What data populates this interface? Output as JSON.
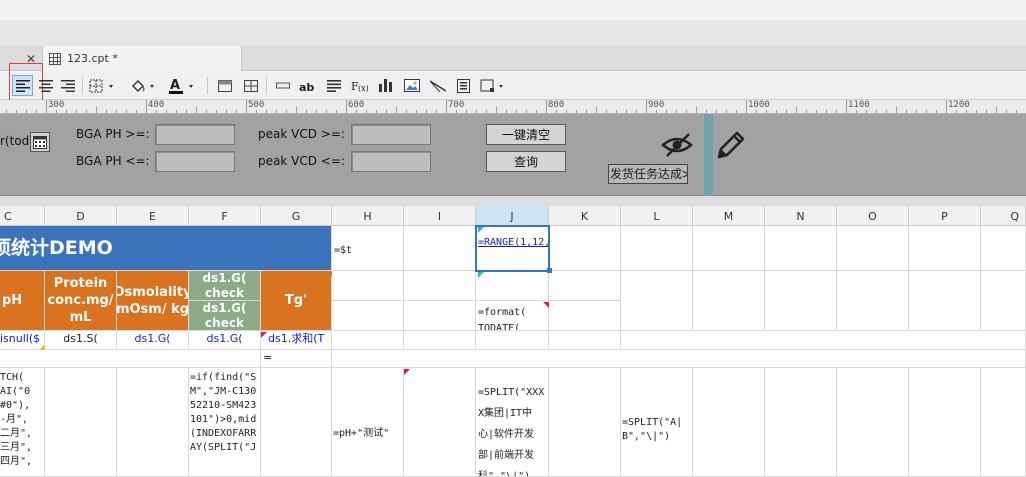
{
  "tabs": {
    "active_label": "123.cpt *"
  },
  "ruler": {
    "labels": [
      "300",
      "400",
      "500",
      "600",
      "700",
      "800",
      "900",
      "1000",
      "1100",
      "1200"
    ]
  },
  "params": {
    "left_label": "r(tod",
    "bga_ph_ge": "BGA PH >=:",
    "bga_ph_le": "BGA PH <=:",
    "peak_vcd_ge": "peak VCD >=:",
    "peak_vcd_le": "peak VCD <=:",
    "clear_btn": "一键清空",
    "query_btn": "查询",
    "shipping_label": "发货任务达成≫"
  },
  "columns": [
    "C",
    "D",
    "E",
    "F",
    "G",
    "H",
    "I",
    "J",
    "K",
    "L",
    "M",
    "N",
    "O",
    "P",
    "Q"
  ],
  "cells": {
    "title": "项统计DEMO",
    "h_formula": "=$t",
    "j_range": "=RANGE(1,12,1)",
    "hdr_ph": "pH",
    "hdr_protein": "Protein conc.mg/ mL",
    "hdr_osmo": "Osmolality mOsm/ kg",
    "hdr_check1": "ds1.G( check",
    "hdr_check2": "ds1.G( check",
    "hdr_tg": "Tg'",
    "j_format": "=format( TODATE(",
    "r3_c": "isnull($",
    "r3_d": "ds1.S(",
    "r3_e": "ds1.G(",
    "r3_f": "ds1.G(",
    "r3_g": "ds1.求和(T",
    "r4_g": "=",
    "r5_c": "TCH(\nAI(\"0\n#0\"),\n-月\",\n二月\",\n三月\",\n四月\",",
    "r5_f": "=if(find(\"SM\",\"JM-C13052210-SM423101\")>0,mid(INDEXOFARRAY(SPLIT(\"J",
    "r5_h": "=pH+\"测试\"",
    "r5_j": "=SPLIT(\"XXXX集团|IT中心|软件开发部|前端开发科\",\"\\|\")",
    "r5_l": "=SPLIT(\"A|B\",\"\\|\")"
  },
  "colors": {
    "title_bg": "#3c73bd",
    "header_orange": "#d9731f",
    "header_green": "#8caa86",
    "param_bg": "#a2a2a2",
    "selection": "#2f74d0",
    "formula_blue": "#1a1acc"
  }
}
